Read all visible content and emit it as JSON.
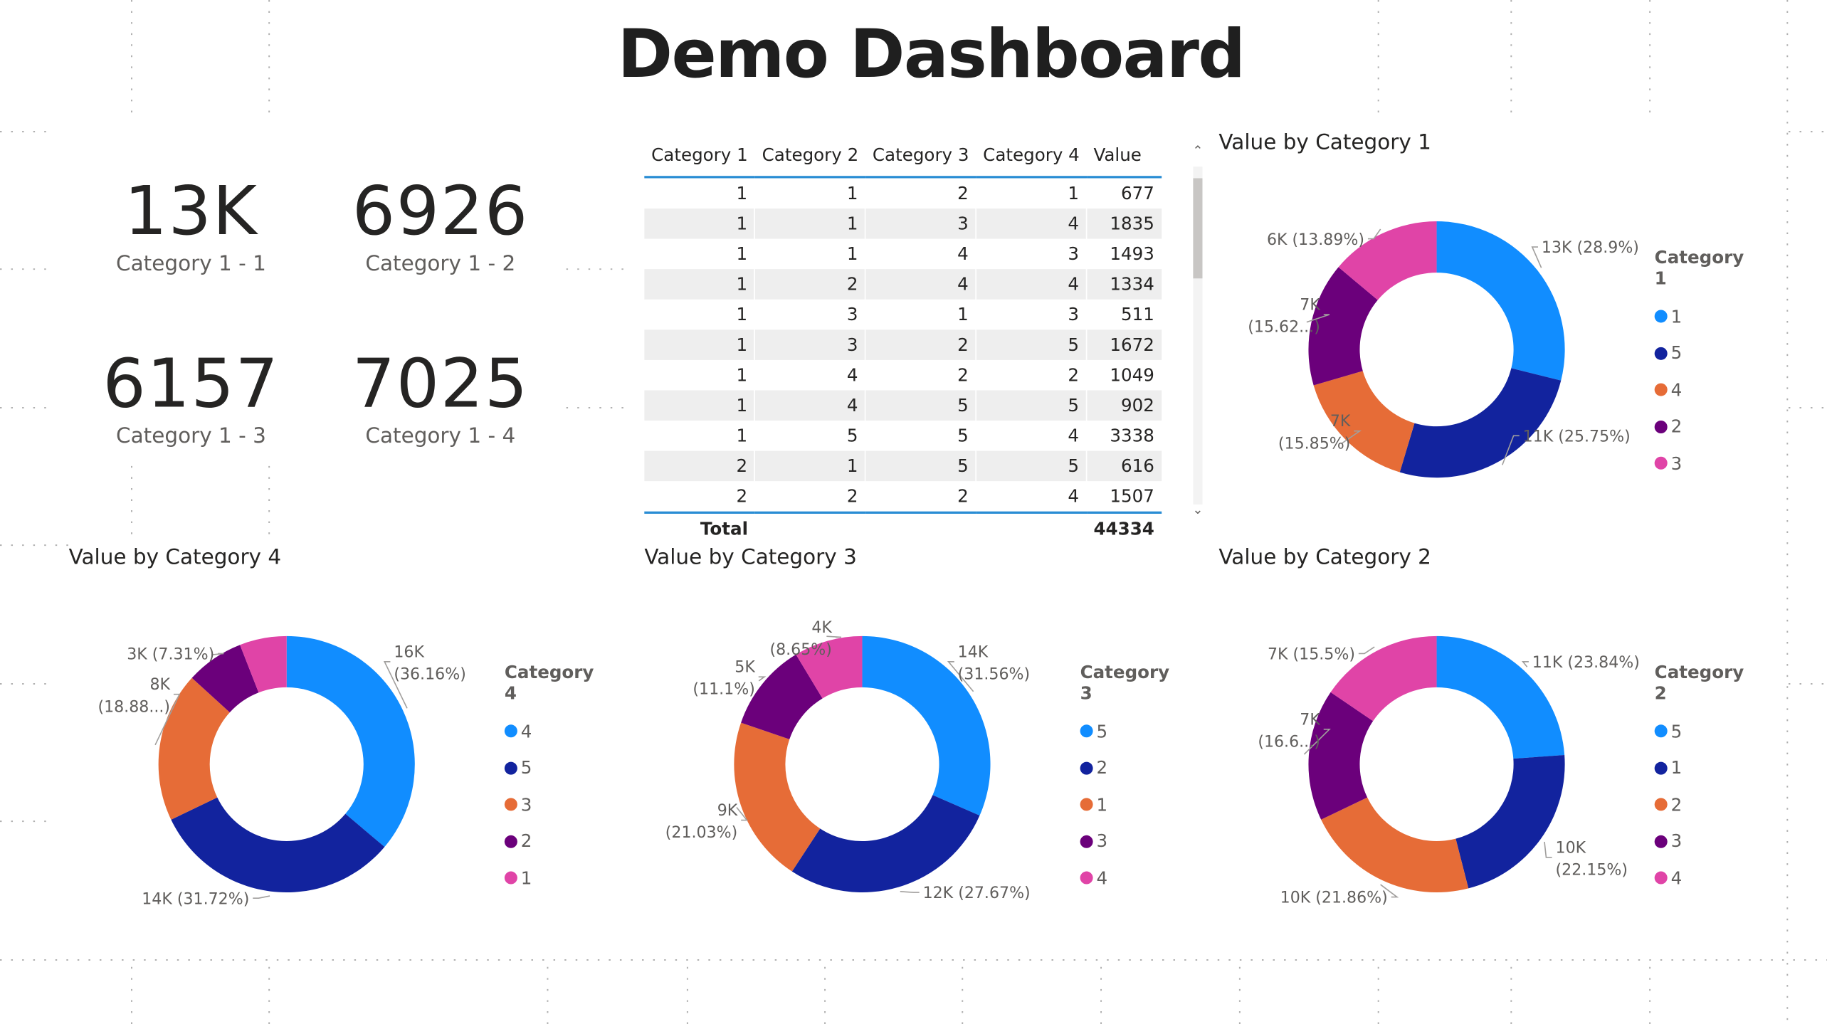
{
  "page": {
    "title": "Demo Dashboard"
  },
  "colors": {
    "blue": "#118DFF",
    "navy": "#12239E",
    "orange": "#E66C37",
    "purple": "#6B007B",
    "pink": "#E044A7",
    "table_accent": "#2A8DD4"
  },
  "cards": [
    {
      "value": "13K",
      "label": "Category 1 - 1"
    },
    {
      "value": "6926",
      "label": "Category 1 - 2"
    },
    {
      "value": "6157",
      "label": "Category 1 - 3"
    },
    {
      "value": "7025",
      "label": "Category 1 - 4"
    }
  ],
  "table": {
    "columns": [
      "Category 1",
      "Category 2",
      "Category 3",
      "Category 4",
      "Value"
    ],
    "rows": [
      [
        "1",
        "1",
        "2",
        "1",
        "677"
      ],
      [
        "1",
        "1",
        "3",
        "4",
        "1835"
      ],
      [
        "1",
        "1",
        "4",
        "3",
        "1493"
      ],
      [
        "1",
        "2",
        "4",
        "4",
        "1334"
      ],
      [
        "1",
        "3",
        "1",
        "3",
        "511"
      ],
      [
        "1",
        "3",
        "2",
        "5",
        "1672"
      ],
      [
        "1",
        "4",
        "2",
        "2",
        "1049"
      ],
      [
        "1",
        "4",
        "5",
        "5",
        "902"
      ],
      [
        "1",
        "5",
        "5",
        "4",
        "3338"
      ],
      [
        "2",
        "1",
        "5",
        "5",
        "616"
      ],
      [
        "2",
        "2",
        "2",
        "4",
        "1507"
      ]
    ],
    "total_label": "Total",
    "total_value": "44334",
    "scroll_up_icon": "chevron-up-icon",
    "scroll_down_icon": "chevron-down-icon"
  },
  "chart_data": [
    {
      "type": "pie",
      "title": "Value by Category 1",
      "legend_title": "Category 1",
      "legend_position": "right",
      "slices": [
        {
          "label": "1",
          "percent": 28.9,
          "value_label": "13K (28.9%)",
          "color": "#118DFF"
        },
        {
          "label": "5",
          "percent": 25.75,
          "value_label": "11K (25.75%)",
          "color": "#12239E"
        },
        {
          "label": "4",
          "percent": 15.85,
          "value_label": "7K (15.85%)",
          "color": "#E66C37"
        },
        {
          "label": "2",
          "percent": 15.62,
          "value_label": "7K (15.62...)",
          "color": "#6B007B"
        },
        {
          "label": "3",
          "percent": 13.89,
          "value_label": "6K (13.89%)",
          "color": "#E044A7"
        }
      ]
    },
    {
      "type": "pie",
      "title": "Value by Category 4",
      "legend_title": "Category 4",
      "legend_position": "right",
      "slices": [
        {
          "label": "4",
          "percent": 36.16,
          "value_label": "16K (36.16%)",
          "color": "#118DFF"
        },
        {
          "label": "5",
          "percent": 31.72,
          "value_label": "14K (31.72%)",
          "color": "#12239E"
        },
        {
          "label": "3",
          "percent": 18.88,
          "value_label": "8K (18.88...)",
          "color": "#E66C37"
        },
        {
          "label": "2",
          "percent": 7.31,
          "value_label": "3K (7.31%)",
          "color": "#6B007B"
        },
        {
          "label": "1",
          "percent": 5.93,
          "value_label": "",
          "color": "#E044A7"
        }
      ]
    },
    {
      "type": "pie",
      "title": "Value by Category 3",
      "legend_title": "Category 3",
      "legend_position": "right",
      "slices": [
        {
          "label": "5",
          "percent": 31.56,
          "value_label": "14K (31.56%)",
          "color": "#118DFF"
        },
        {
          "label": "2",
          "percent": 27.67,
          "value_label": "12K (27.67%)",
          "color": "#12239E"
        },
        {
          "label": "1",
          "percent": 21.03,
          "value_label": "9K (21.03%)",
          "color": "#E66C37"
        },
        {
          "label": "3",
          "percent": 11.1,
          "value_label": "5K (11.1%)",
          "color": "#6B007B"
        },
        {
          "label": "4",
          "percent": 8.65,
          "value_label": "4K (8.65%)",
          "color": "#E044A7"
        }
      ]
    },
    {
      "type": "pie",
      "title": "Value by Category 2",
      "legend_title": "Category 2",
      "legend_position": "right",
      "slices": [
        {
          "label": "5",
          "percent": 23.84,
          "value_label": "11K (23.84%)",
          "color": "#118DFF"
        },
        {
          "label": "1",
          "percent": 22.15,
          "value_label": "10K (22.15%)",
          "color": "#12239E"
        },
        {
          "label": "2",
          "percent": 21.86,
          "value_label": "10K (21.86%)",
          "color": "#E66C37"
        },
        {
          "label": "3",
          "percent": 16.6,
          "value_label": "7K (16.6...)",
          "color": "#6B007B"
        },
        {
          "label": "4",
          "percent": 15.5,
          "value_label": "7K (15.5%)",
          "color": "#E044A7"
        }
      ]
    }
  ]
}
